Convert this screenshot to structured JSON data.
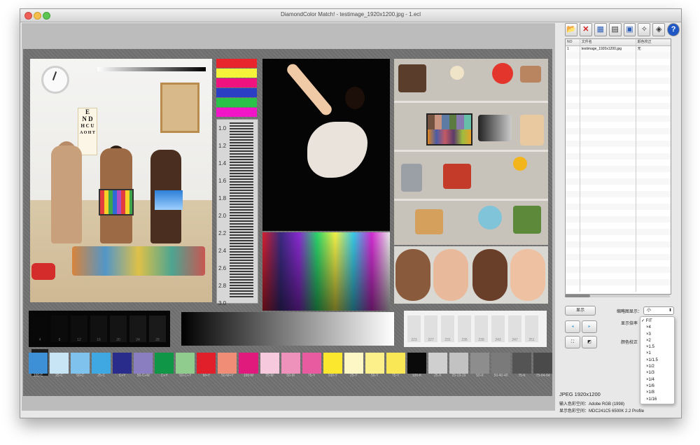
{
  "window": {
    "title": "DiamondColor Match! - testimage_1920x1200.jpg - 1.ecl"
  },
  "toolbar": {
    "buttons": [
      {
        "name": "open-folder-icon",
        "glyph": "📂"
      },
      {
        "name": "close-x-icon",
        "glyph": "✕"
      },
      {
        "name": "scanner-icon",
        "glyph": "▦"
      },
      {
        "name": "document-icon",
        "glyph": "▤"
      },
      {
        "name": "monitor-icon",
        "glyph": "▣"
      },
      {
        "name": "magic-wand-icon",
        "glyph": "✧"
      },
      {
        "name": "color-book-icon",
        "glyph": "◈"
      },
      {
        "name": "help-icon",
        "glyph": "?"
      }
    ]
  },
  "file_list": {
    "headers": [
      "NO",
      "文件名",
      "颜色校正"
    ],
    "rows": [
      {
        "no": "1",
        "name": "testimage_1920x1200.jpg",
        "correction": "无"
      }
    ]
  },
  "controls": {
    "display_button": "显示",
    "thumbnail_label": "缩略图显示：",
    "thumbnail_value": "小",
    "display_ratio_label": "显示倍率",
    "color_correction_label": "颜色校正",
    "zoom_options": [
      "✓ FIT",
      "×4",
      "×3",
      "×2",
      "×1.5",
      "×1",
      "×1/1.5",
      "×1/2",
      "×1/3",
      "×1/4",
      "×1/6",
      "×1/8",
      "×1/16"
    ],
    "nav_left": "◂",
    "nav_right": "▸"
  },
  "image_info": {
    "format": "JPEG 1920x1200",
    "input_label": "输入色彩空间：",
    "input_value": "Adobe RGB (1998)",
    "display_label": "显示色彩空间：",
    "display_value": "MDC241C5 6500K 2.2 Profile"
  },
  "test_image": {
    "eye_chart": [
      "E",
      "N D",
      "H C U",
      "A O H T"
    ],
    "gray_scale_ticks": [
      "1.0",
      "1.2",
      "1.4",
      "1.6",
      "1.8",
      "2.0",
      "2.2",
      "2.4",
      "2.6",
      "2.8",
      "3.0"
    ],
    "dark_patch_labels": [
      "4",
      "8",
      "12",
      "16",
      "20",
      "24",
      "28",
      "32"
    ],
    "light_patch_labels": [
      "223",
      "227",
      "231",
      "235",
      "239",
      "243",
      "247",
      "251"
    ],
    "color_patches": [
      {
        "label": "100-C",
        "color": "#3d8fd6"
      },
      {
        "label": "25-C",
        "color": "#c8e5f6"
      },
      {
        "label": "50-C",
        "color": "#7fc2ed"
      },
      {
        "label": "25-C",
        "color": "#3fa7e2"
      },
      {
        "label": "C+Y",
        "color": "#2a2c8c"
      },
      {
        "label": "50-C+M",
        "color": "#8a7ec0"
      },
      {
        "label": "C+Y",
        "color": "#0f9646"
      },
      {
        "label": "50-C+Y",
        "color": "#8fcc8e"
      },
      {
        "label": "M+Y",
        "color": "#e01f2a"
      },
      {
        "label": "50-M+Y",
        "color": "#ef8d77"
      },
      {
        "label": "100-M",
        "color": "#e0197c"
      },
      {
        "label": "25-M",
        "color": "#f6c9dc"
      },
      {
        "label": "50-M",
        "color": "#ef92bb"
      },
      {
        "label": "75-Y",
        "color": "#e85ba0"
      },
      {
        "label": "100-Y",
        "color": "#fbe82e"
      },
      {
        "label": "25-Y",
        "color": "#fdf7c5"
      },
      {
        "label": "50-Y",
        "color": "#fcf08a"
      },
      {
        "label": "75-Y",
        "color": "#f9e755"
      },
      {
        "label": "100-K",
        "color": "#0a0a0a"
      },
      {
        "label": "25-K",
        "color": "#cfcfcf"
      },
      {
        "label": "25-19-19",
        "color": "#c2c2c2"
      },
      {
        "label": "50-K",
        "color": "#8d8d8d"
      },
      {
        "label": "50-40-40",
        "color": "#7a7a7a"
      },
      {
        "label": "75-K",
        "color": "#545454"
      },
      {
        "label": "75-64-64",
        "color": "#4a4a4a"
      }
    ],
    "top_bars": [
      "#e8242c",
      "#f5f23a",
      "#f0127e",
      "#2a3fc4",
      "#2bc24a",
      "#f215c8"
    ]
  }
}
